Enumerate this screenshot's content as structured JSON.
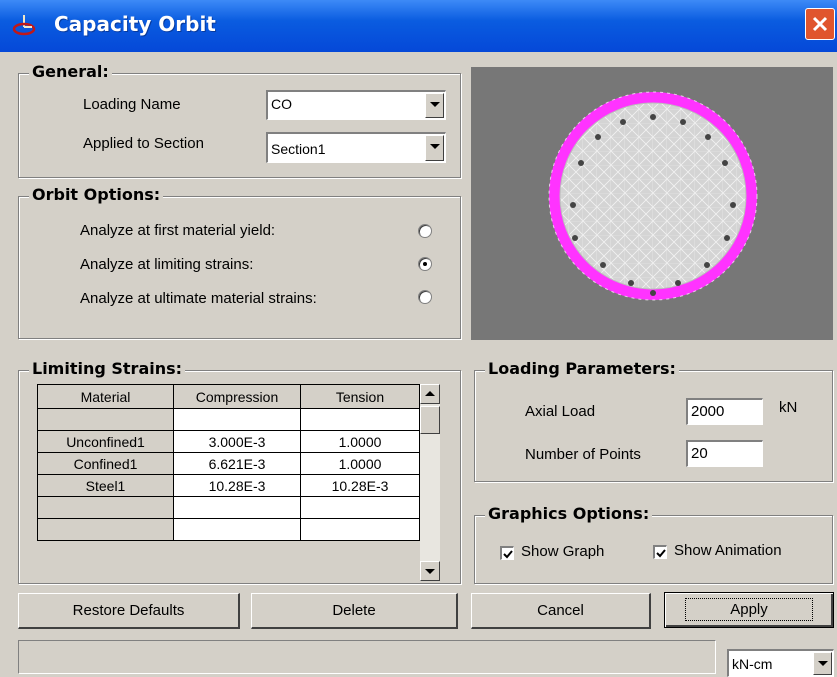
{
  "window": {
    "title": "Capacity Orbit"
  },
  "general": {
    "legend": "General:",
    "loading_name_label": "Loading Name",
    "loading_name_value": "CO",
    "applied_to_label": "Applied to Section",
    "applied_to_value": "Section1"
  },
  "orbit_options": {
    "legend": "Orbit Options:",
    "options": [
      {
        "label": "Analyze at first material yield:",
        "selected": false
      },
      {
        "label": "Analyze at limiting strains:",
        "selected": true
      },
      {
        "label": "Analyze at ultimate material strains:",
        "selected": false
      }
    ]
  },
  "preview": {
    "background": "#777777",
    "confined_color": "#d4d4d4",
    "cover_color": "#ff33ff"
  },
  "limiting_strains": {
    "legend": "Limiting Strains:",
    "headers": [
      "Material",
      "Compression",
      "Tension"
    ],
    "rows": [
      [
        "",
        "",
        ""
      ],
      [
        "Unconfined1",
        "3.000E-3",
        "1.0000"
      ],
      [
        "Confined1",
        "6.621E-3",
        "1.0000"
      ],
      [
        "Steel1",
        "10.28E-3",
        "10.28E-3"
      ],
      [
        "",
        "",
        ""
      ],
      [
        "",
        "",
        ""
      ]
    ]
  },
  "loading_parameters": {
    "legend": "Loading Parameters:",
    "axial_load_label": "Axial Load",
    "axial_load_value": "2000",
    "axial_load_unit": "kN",
    "points_label": "Number of Points",
    "points_value": "20"
  },
  "graphics_options": {
    "legend": "Graphics Options:",
    "show_graph_label": "Show Graph",
    "show_graph_checked": true,
    "show_animation_label": "Show Animation",
    "show_animation_checked": true
  },
  "buttons": {
    "restore": "Restore Defaults",
    "delete": "Delete",
    "cancel": "Cancel",
    "apply": "Apply"
  },
  "status": {
    "units": "kN-cm"
  }
}
